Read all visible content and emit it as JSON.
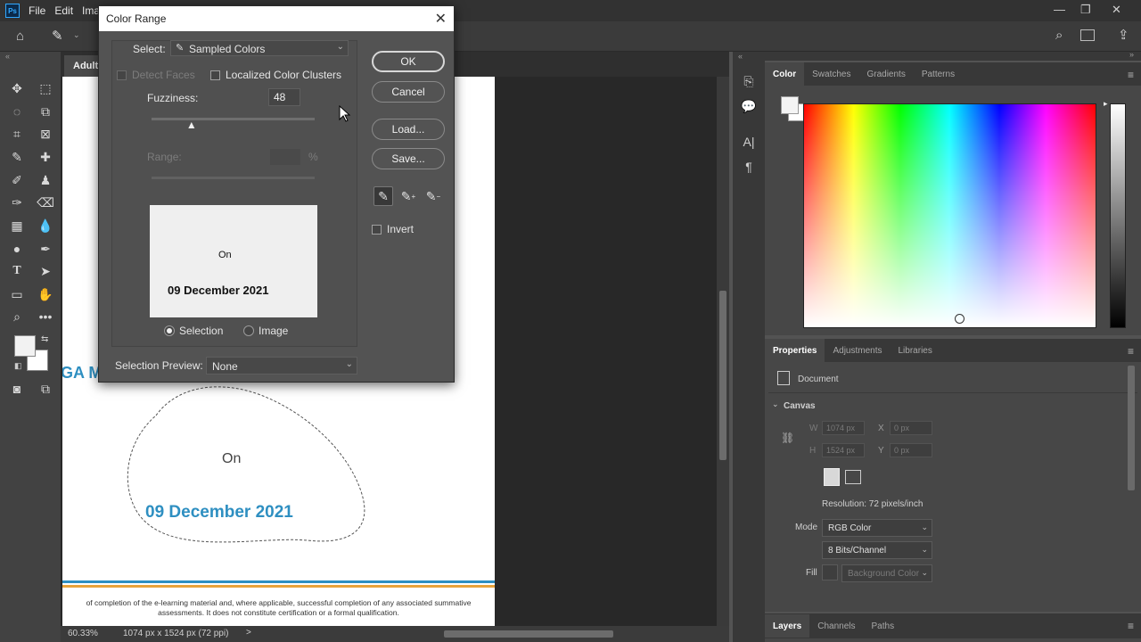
{
  "menubar": {
    "logo": "Ps",
    "items": [
      "File",
      "Edit",
      "Ima"
    ],
    "controls": {
      "minimize": "—",
      "restore": "❐",
      "close": "✕"
    }
  },
  "document": {
    "tab_title": "Adult :",
    "text_on": "On",
    "text_date": "09 December 2021",
    "text_partial": "GA M",
    "footer_line1": "of completion of the e-learning material and, where applicable, successful completion of any associated summative",
    "footer_line2": "assessments. It does not constitute certification or a formal qualification.",
    "accent_color": "#2e8fc1"
  },
  "statusbar": {
    "zoom": "60.33%",
    "dimensions": "1074 px x 1524 px (72 ppi)",
    "arrow": ">"
  },
  "color_panel": {
    "tabs": [
      "Color",
      "Swatches",
      "Gradients",
      "Patterns"
    ]
  },
  "properties_panel": {
    "tabs": [
      "Properties",
      "Adjustments",
      "Libraries"
    ],
    "document_label": "Document",
    "canvas_section": "Canvas",
    "w_label": "W",
    "w_value": "1074 px",
    "h_label": "H",
    "h_value": "1524 px",
    "x_label": "X",
    "x_value": "0 px",
    "y_label": "Y",
    "y_value": "0 px",
    "resolution": "Resolution: 72 pixels/inch",
    "mode_label": "Mode",
    "mode_value": "RGB Color",
    "bits_value": "8 Bits/Channel",
    "fill_label": "Fill",
    "fill_value": "Background Color"
  },
  "layers_panel": {
    "tabs": [
      "Layers",
      "Channels",
      "Paths"
    ]
  },
  "dialog": {
    "title": "Color Range",
    "close": "✕",
    "select_label": "Select:",
    "select_value": "Sampled Colors",
    "detect_faces": "Detect Faces",
    "localized_clusters": "Localized Color Clusters",
    "fuzziness_label": "Fuzziness:",
    "fuzziness_value": "48",
    "fuzziness_fraction": 0.24,
    "range_label": "Range:",
    "range_value": "",
    "range_unit": "%",
    "preview_text_on": "On",
    "preview_text_date": "09 December 2021",
    "radio_selection": "Selection",
    "radio_image": "Image",
    "selection_preview_label": "Selection Preview:",
    "selection_preview_value": "None",
    "btn_ok": "OK",
    "btn_cancel": "Cancel",
    "btn_load": "Load...",
    "btn_save": "Save...",
    "invert_label": "Invert"
  }
}
